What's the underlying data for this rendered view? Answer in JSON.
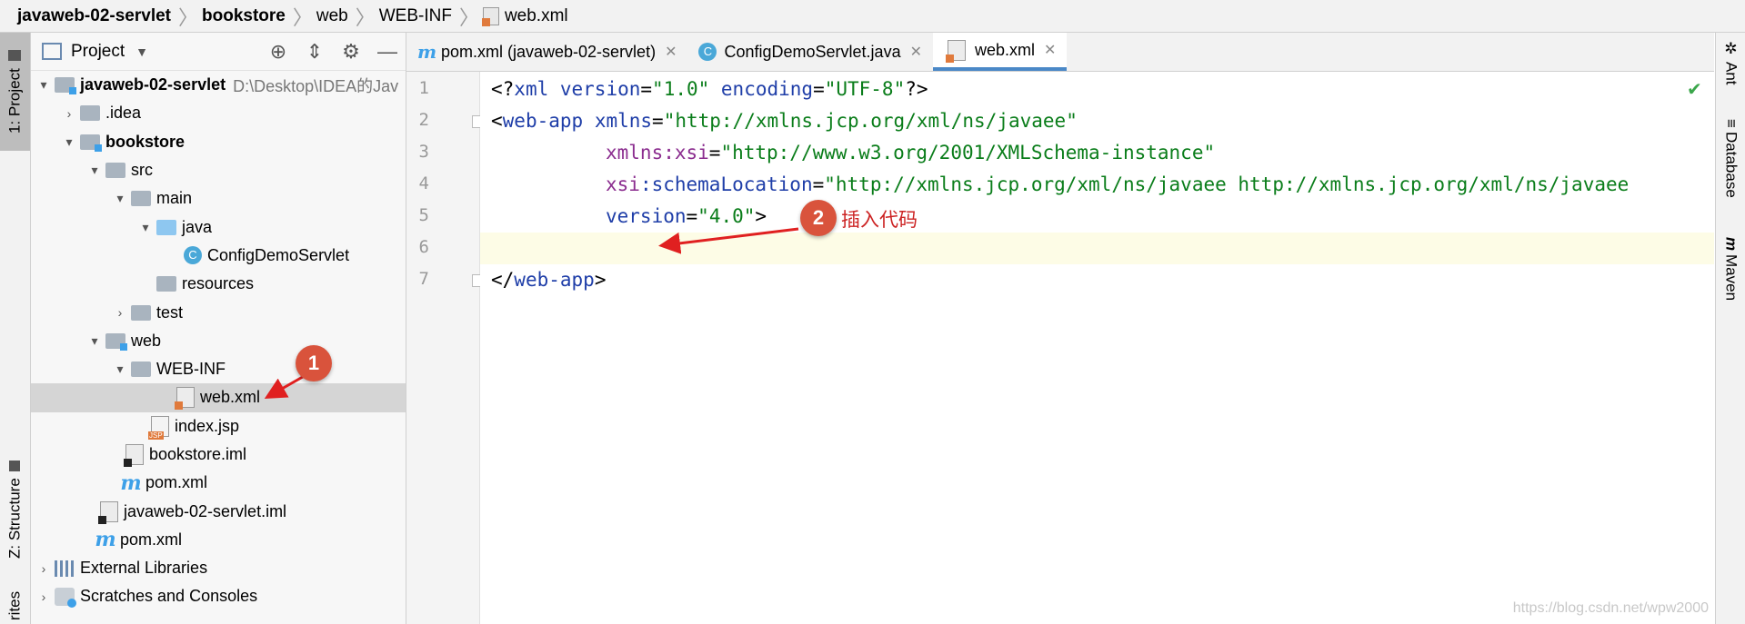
{
  "breadcrumb": [
    "javaweb-02-servlet",
    "bookstore",
    "web",
    "WEB-INF",
    "web.xml"
  ],
  "left_strip": {
    "project_tab": "1: Project",
    "structure_tab": "Z: Structure",
    "favorites_tab": "rites"
  },
  "project_panel": {
    "title": "Project"
  },
  "tree": [
    {
      "label": "javaweb-02-servlet",
      "path": "D:\\Desktop\\IDEA的Jav"
    },
    {
      "label": ".idea"
    },
    {
      "label": "bookstore"
    },
    {
      "label": "src"
    },
    {
      "label": "main"
    },
    {
      "label": "java"
    },
    {
      "label": "ConfigDemoServlet"
    },
    {
      "label": "resources"
    },
    {
      "label": "test"
    },
    {
      "label": "web"
    },
    {
      "label": "WEB-INF"
    },
    {
      "label": "web.xml"
    },
    {
      "label": "index.jsp"
    },
    {
      "label": "bookstore.iml"
    },
    {
      "label": "pom.xml"
    },
    {
      "label": "javaweb-02-servlet.iml"
    },
    {
      "label": "pom.xml"
    },
    {
      "label": "External Libraries"
    },
    {
      "label": "Scratches and Consoles"
    }
  ],
  "tabs": [
    {
      "label": "pom.xml (javaweb-02-servlet)"
    },
    {
      "label": "ConfigDemoServlet.java"
    },
    {
      "label": "web.xml"
    }
  ],
  "code": {
    "line_numbers": [
      "1",
      "2",
      "3",
      "4",
      "5",
      "6",
      "7"
    ],
    "l1_open": "<?",
    "l1_xml": "xml",
    "l1_a1": " version",
    "l1_eq1": "=",
    "l1_v1": "\"1.0\"",
    "l1_a2": " encoding",
    "l1_eq2": "=",
    "l1_v2": "\"UTF-8\"",
    "l1_close": "?>",
    "l2_lt": "<",
    "l2_tag": "web-app",
    "l2_a": " xmlns",
    "l2_eq": "=",
    "l2_v": "\"http://xmlns.jcp.org/xml/ns/javaee\"",
    "l3_ns": "xmlns:xsi",
    "l3_eq": "=",
    "l3_v": "\"http://www.w3.org/2001/XMLSchema-instance\"",
    "l4_ns": "xsi",
    "l4_a": ":schemaLocation",
    "l4_eq": "=",
    "l4_v": "\"http://xmlns.jcp.org/xml/ns/javaee http://xmlns.jcp.org/xml/ns/javaee",
    "l5_a": "version",
    "l5_eq": "=",
    "l5_v": "\"4.0\"",
    "l5_gt": ">",
    "l7_lt": "</",
    "l7_tag": "web-app",
    "l7_gt": ">"
  },
  "annotations": {
    "badge1": "1",
    "badge2": "2",
    "insert_text": "插入代码"
  },
  "right_strip": [
    "Ant",
    "Database",
    "Maven"
  ],
  "watermark": "https://blog.csdn.net/wpw2000",
  "colors": {
    "tag": "#1f3ea8",
    "namespace": "#8b2d8f",
    "value": "#0a7d1a",
    "annotation": "#d9533c",
    "selection": "#d5d5d5"
  }
}
